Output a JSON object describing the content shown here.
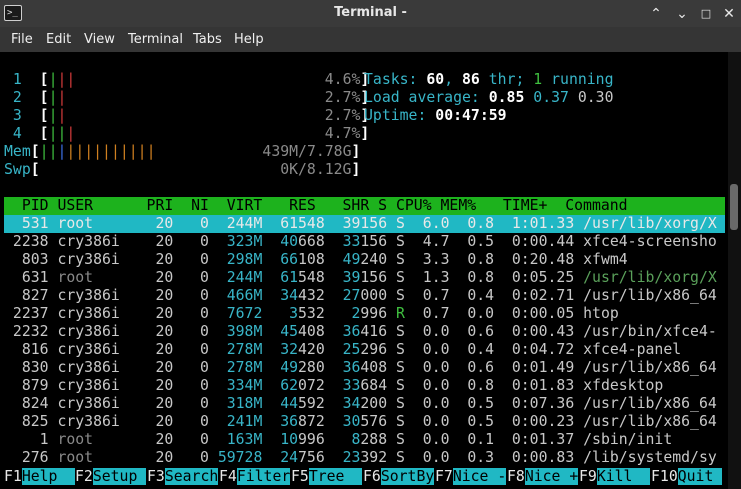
{
  "window": {
    "title": "Terminal -"
  },
  "menubar": {
    "items": [
      "File",
      "Edit",
      "View",
      "Terminal",
      "Tabs",
      "Help"
    ]
  },
  "meters": {
    "cpu": [
      {
        "id": "1",
        "bar": [
          "|",
          "||"
        ],
        "value": "4.6%]"
      },
      {
        "id": "2",
        "bar": [
          "|",
          "|"
        ],
        "value": "2.7%]"
      },
      {
        "id": "3",
        "bar": [
          "|",
          "|"
        ],
        "value": "2.7%]"
      },
      {
        "id": "4",
        "bar": [
          "||",
          "|"
        ],
        "value": "4.7%]"
      }
    ],
    "mem": {
      "label": "Mem",
      "bar": [
        "||",
        "|",
        "||||||||||"
      ],
      "value": "439M/7.78G]"
    },
    "swp": {
      "label": "Swp",
      "value": "0K/8.12G]"
    }
  },
  "summary": {
    "tasks_label": "Tasks: ",
    "tasks": "60",
    "sep": ", ",
    "threads": "86",
    "threads_label": " thr; ",
    "running": "1",
    "running_label": " running",
    "load_label": "Load average: ",
    "load1": "0.85",
    "load5": "0.37",
    "load15": "0.30",
    "uptime_label": "Uptime: ",
    "uptime": "00:47:59"
  },
  "table": {
    "header": "  PID USER      PRI  NI  VIRT   RES   SHR S CPU% MEM%   TIME+  Command",
    "selected_index": 0,
    "rows": [
      {
        "pid": "531",
        "user": "root",
        "pri": "20",
        "ni": "0",
        "virt": "244M",
        "res": "61548",
        "shr": "39156",
        "s": "S",
        "cpu": "6.0",
        "mem": "0.8",
        "time": "1:01.33",
        "cmd": "/usr/lib/xorg/X"
      },
      {
        "pid": "2238",
        "user": "cry386i",
        "pri": "20",
        "ni": "0",
        "virt": "323M",
        "res": "40668",
        "shr": "33156",
        "s": "S",
        "cpu": "4.7",
        "mem": "0.5",
        "time": "0:00.44",
        "cmd": "xfce4-screensho"
      },
      {
        "pid": "803",
        "user": "cry386i",
        "pri": "20",
        "ni": "0",
        "virt": "298M",
        "res": "66108",
        "shr": "49240",
        "s": "S",
        "cpu": "3.3",
        "mem": "0.8",
        "time": "0:20.48",
        "cmd": "xfwm4"
      },
      {
        "pid": "631",
        "user": "root",
        "pri": "20",
        "ni": "0",
        "virt": "244M",
        "res": "61548",
        "shr": "39156",
        "s": "S",
        "cpu": "1.3",
        "mem": "0.8",
        "time": "0:05.25",
        "cmd": "/usr/lib/xorg/X"
      },
      {
        "pid": "827",
        "user": "cry386i",
        "pri": "20",
        "ni": "0",
        "virt": "466M",
        "res": "34432",
        "shr": "27000",
        "s": "S",
        "cpu": "0.7",
        "mem": "0.4",
        "time": "0:02.71",
        "cmd": "/usr/lib/x86_64"
      },
      {
        "pid": "2237",
        "user": "cry386i",
        "pri": "20",
        "ni": "0",
        "virt": "7672",
        "res": "3532",
        "shr": "2996",
        "s": "R",
        "cpu": "0.7",
        "mem": "0.0",
        "time": "0:00.05",
        "cmd": "htop"
      },
      {
        "pid": "2232",
        "user": "cry386i",
        "pri": "20",
        "ni": "0",
        "virt": "398M",
        "res": "45408",
        "shr": "36416",
        "s": "S",
        "cpu": "0.0",
        "mem": "0.6",
        "time": "0:00.43",
        "cmd": "/usr/bin/xfce4-"
      },
      {
        "pid": "816",
        "user": "cry386i",
        "pri": "20",
        "ni": "0",
        "virt": "278M",
        "res": "32420",
        "shr": "25296",
        "s": "S",
        "cpu": "0.0",
        "mem": "0.4",
        "time": "0:04.72",
        "cmd": "xfce4-panel"
      },
      {
        "pid": "830",
        "user": "cry386i",
        "pri": "20",
        "ni": "0",
        "virt": "278M",
        "res": "49280",
        "shr": "36408",
        "s": "S",
        "cpu": "0.0",
        "mem": "0.6",
        "time": "0:01.49",
        "cmd": "/usr/lib/x86_64"
      },
      {
        "pid": "879",
        "user": "cry386i",
        "pri": "20",
        "ni": "0",
        "virt": "334M",
        "res": "62072",
        "shr": "33684",
        "s": "S",
        "cpu": "0.0",
        "mem": "0.8",
        "time": "0:01.83",
        "cmd": "xfdesktop"
      },
      {
        "pid": "824",
        "user": "cry386i",
        "pri": "20",
        "ni": "0",
        "virt": "318M",
        "res": "44592",
        "shr": "34200",
        "s": "S",
        "cpu": "0.0",
        "mem": "0.5",
        "time": "0:07.36",
        "cmd": "/usr/lib/x86_64"
      },
      {
        "pid": "825",
        "user": "cry386i",
        "pri": "20",
        "ni": "0",
        "virt": "241M",
        "res": "36872",
        "shr": "30576",
        "s": "S",
        "cpu": "0.0",
        "mem": "0.5",
        "time": "0:00.23",
        "cmd": "/usr/lib/x86_64"
      },
      {
        "pid": "1",
        "user": "root",
        "pri": "20",
        "ni": "0",
        "virt": "163M",
        "res": "10996",
        "shr": "8288",
        "s": "S",
        "cpu": "0.0",
        "mem": "0.1",
        "time": "0:01.37",
        "cmd": "/sbin/init"
      },
      {
        "pid": "276",
        "user": "root",
        "pri": "20",
        "ni": "0",
        "virt": "59728",
        "res": "24756",
        "shr": "23392",
        "s": "S",
        "cpu": "0.0",
        "mem": "0.3",
        "time": "0:00.83",
        "cmd": "/lib/systemd/sy"
      }
    ]
  },
  "function_keys": [
    {
      "key": "F1",
      "label": "Help  "
    },
    {
      "key": "F2",
      "label": "Setup "
    },
    {
      "key": "F3",
      "label": "Search"
    },
    {
      "key": "F4",
      "label": "Filter"
    },
    {
      "key": "F5",
      "label": "Tree  "
    },
    {
      "key": "F6",
      "label": "SortBy"
    },
    {
      "key": "F7",
      "label": "Nice -"
    },
    {
      "key": "F8",
      "label": "Nice +"
    },
    {
      "key": "F9",
      "label": "Kill  "
    },
    {
      "key": "F10",
      "label": "Quit "
    }
  ],
  "colors": {
    "header_bg": "#1db21d",
    "selected_bg": "#20b8c4",
    "label_cyan": "#38b5c8",
    "terminal_bg": "#000000"
  }
}
